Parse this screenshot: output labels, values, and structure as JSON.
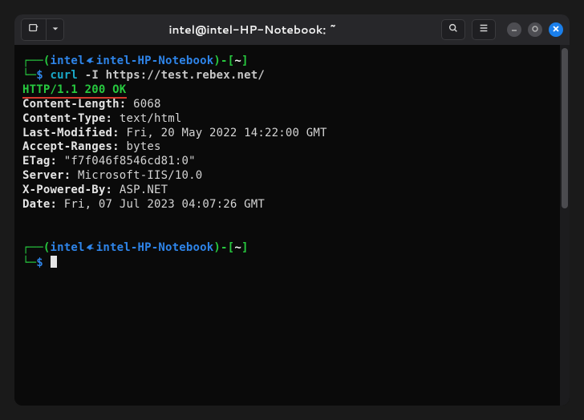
{
  "titlebar": {
    "title": "intel@intel-HP-Notebook: ~"
  },
  "prompt": {
    "open_paren": "(",
    "user": "intel",
    "at": "㉿",
    "host": "intel-HP-Notebook",
    "close_paren": ")",
    "dash": "-",
    "lbracket": "[",
    "cwd": "~",
    "rbracket": "]",
    "symbol": "$"
  },
  "command": {
    "cmd": "curl",
    "args": "-I https://test.rebex.net/"
  },
  "response": {
    "status_line": "HTTP/1.1 200 OK",
    "headers": [
      {
        "key": "Content-Length:",
        "val": " 6068"
      },
      {
        "key": "Content-Type:",
        "val": " text/html"
      },
      {
        "key": "Last-Modified:",
        "val": " Fri, 20 May 2022 14:22:00 GMT"
      },
      {
        "key": "Accept-Ranges:",
        "val": " bytes"
      },
      {
        "key": "ETag:",
        "val": " \"f7f046f8546cd81:0\""
      },
      {
        "key": "Server:",
        "val": " Microsoft-IIS/10.0"
      },
      {
        "key": "X-Powered-By:",
        "val": " ASP.NET"
      },
      {
        "key": "Date:",
        "val": " Fri, 07 Jul 2023 04:07:26 GMT"
      }
    ]
  },
  "icons": {
    "newtab": "new-tab-icon",
    "dropdown": "chevron-down-icon",
    "search": "search-icon",
    "menu": "hamburger-icon",
    "min": "minimize-icon",
    "max": "maximize-icon",
    "close": "close-icon",
    "dragon": "kali-dragon-icon"
  }
}
